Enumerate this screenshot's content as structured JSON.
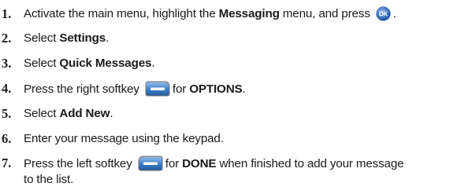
{
  "steps": [
    {
      "number": "1.",
      "parts": [
        "Activate the main menu, highlight the ",
        "Messaging",
        " menu, and press "
      ],
      "icon": "ok-button-icon",
      "icon_label": "OK",
      "end": "."
    },
    {
      "number": "2.",
      "parts": [
        "Select ",
        "Settings",
        "."
      ]
    },
    {
      "number": "3.",
      "parts": [
        "Select ",
        "Quick Messages",
        "."
      ]
    },
    {
      "number": "4.",
      "parts": [
        "Press the right softkey ",
        "for ",
        "OPTIONS",
        "."
      ],
      "icon": "right-softkey-icon"
    },
    {
      "number": "5.",
      "parts": [
        "Select ",
        "Add New",
        "."
      ]
    },
    {
      "number": "6.",
      "parts": [
        "Enter your message using the keypad."
      ]
    },
    {
      "number": "7.",
      "parts": [
        "Press the left softkey ",
        "for ",
        "DONE",
        " when finished to add your message",
        "to the list."
      ],
      "icon": "left-softkey-icon"
    }
  ],
  "colors": {
    "text": "#1a1a1a",
    "icon_blue": "#3a73c0",
    "softkey_blue": "#3d7fc6"
  }
}
